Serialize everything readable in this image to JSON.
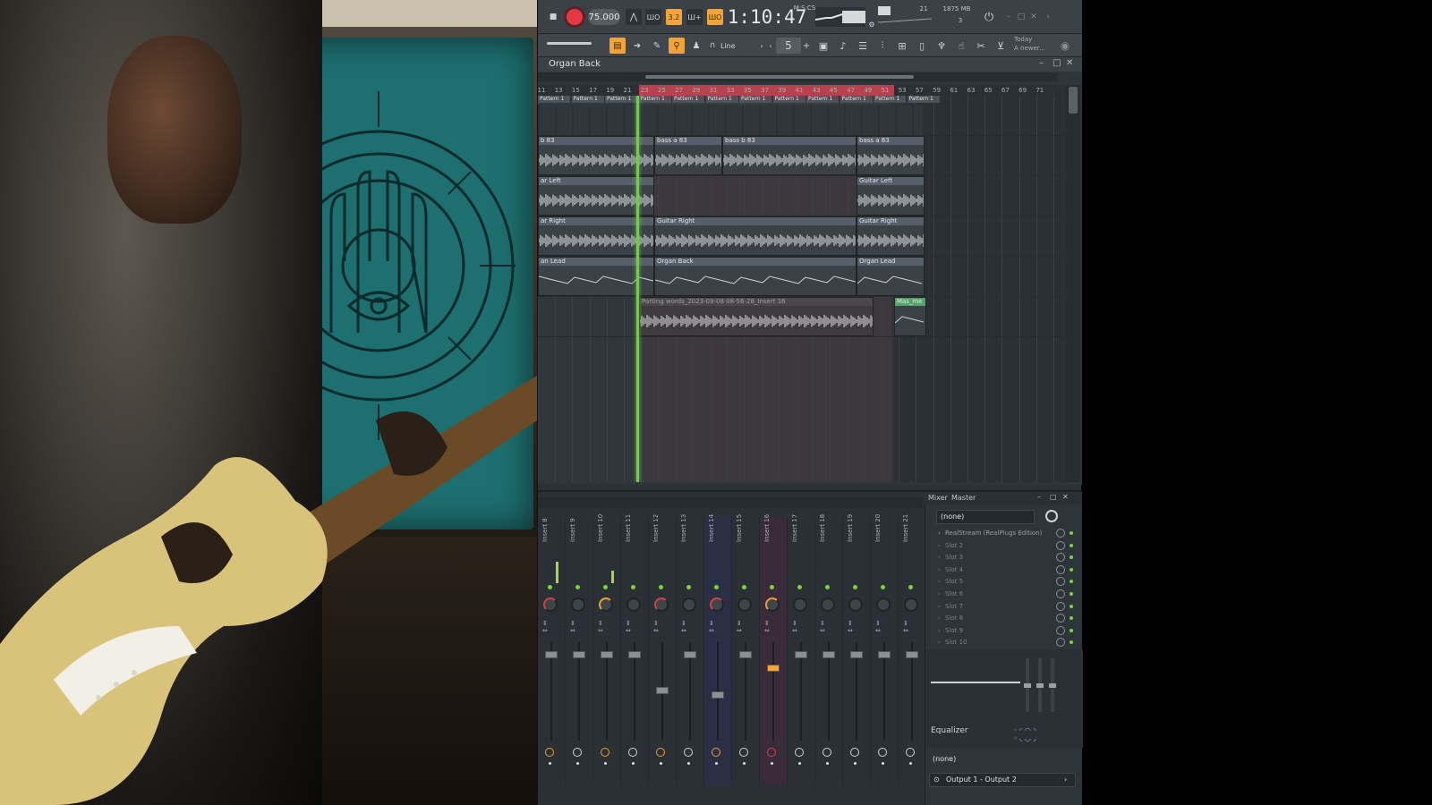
{
  "transport": {
    "tempo": "75.000",
    "pattern_song": "3.2",
    "clock": "1:10:47",
    "clock_unit": "M:S:CS",
    "memory": "1875 MB",
    "cpu_voices": "21",
    "polyphony": "3"
  },
  "toolbar2": {
    "snap_mode": "Line",
    "pattern_number": "5",
    "hint_title": "Today",
    "hint_text": "A newer..."
  },
  "playlist": {
    "title": "Organ Back",
    "ruler_numbers": [
      "11",
      "13",
      "15",
      "17",
      "19",
      "21",
      "23",
      "25",
      "27",
      "29",
      "31",
      "33",
      "35",
      "37",
      "39",
      "41",
      "43",
      "45",
      "47",
      "49",
      "51",
      "53",
      "57",
      "59",
      "61",
      "63",
      "65",
      "67",
      "69",
      "71"
    ],
    "pattern_label": "Pattern 1",
    "tracks": [
      {
        "clips": [
          {
            "label": "b 83"
          },
          {
            "label": "bass a 83"
          },
          {
            "label": "bass b 83"
          },
          {
            "label": "bass a 83"
          }
        ]
      },
      {
        "clips": [
          {
            "label": "ar Left"
          },
          {
            "label": "Guitar Left"
          }
        ]
      },
      {
        "clips": [
          {
            "label": "ar Right"
          },
          {
            "label": "Guitar Right"
          },
          {
            "label": "Guitar Right"
          }
        ]
      },
      {
        "clips": [
          {
            "label": "an Lead"
          },
          {
            "label": "Organ Back"
          },
          {
            "label": "Organ Lead"
          }
        ]
      },
      {
        "clips": [
          {
            "label": "Parting words_2023-09-08 08-56-28_Insert 16"
          },
          {
            "label": "Mas_me"
          }
        ]
      }
    ]
  },
  "mixer": {
    "title": "Mixer",
    "subtitle": "Master",
    "inserts": [
      "Insert 8",
      "Insert 9",
      "Insert 10",
      "Insert 11",
      "Insert 12",
      "Insert 13",
      "Insert 14",
      "Insert 15",
      "Insert 16",
      "Insert 17",
      "Insert 18",
      "Insert 19",
      "Insert 20",
      "Insert 21"
    ],
    "input_select": "(none)",
    "slots": [
      "RealStream (RealPlugs Edition)",
      "Slot 2",
      "Slot 3",
      "Slot 4",
      "Slot 5",
      "Slot 6",
      "Slot 7",
      "Slot 8",
      "Slot 9",
      "Slot 10"
    ],
    "equalizer_label": "Equalizer",
    "send_select": "(none)",
    "output": "Output 1 - Output 2"
  },
  "colors": {
    "accent_orange": "#f2a43a",
    "record_red": "#e53845",
    "playhead_green": "#6ad33a",
    "loop_red": "#b5424e"
  }
}
